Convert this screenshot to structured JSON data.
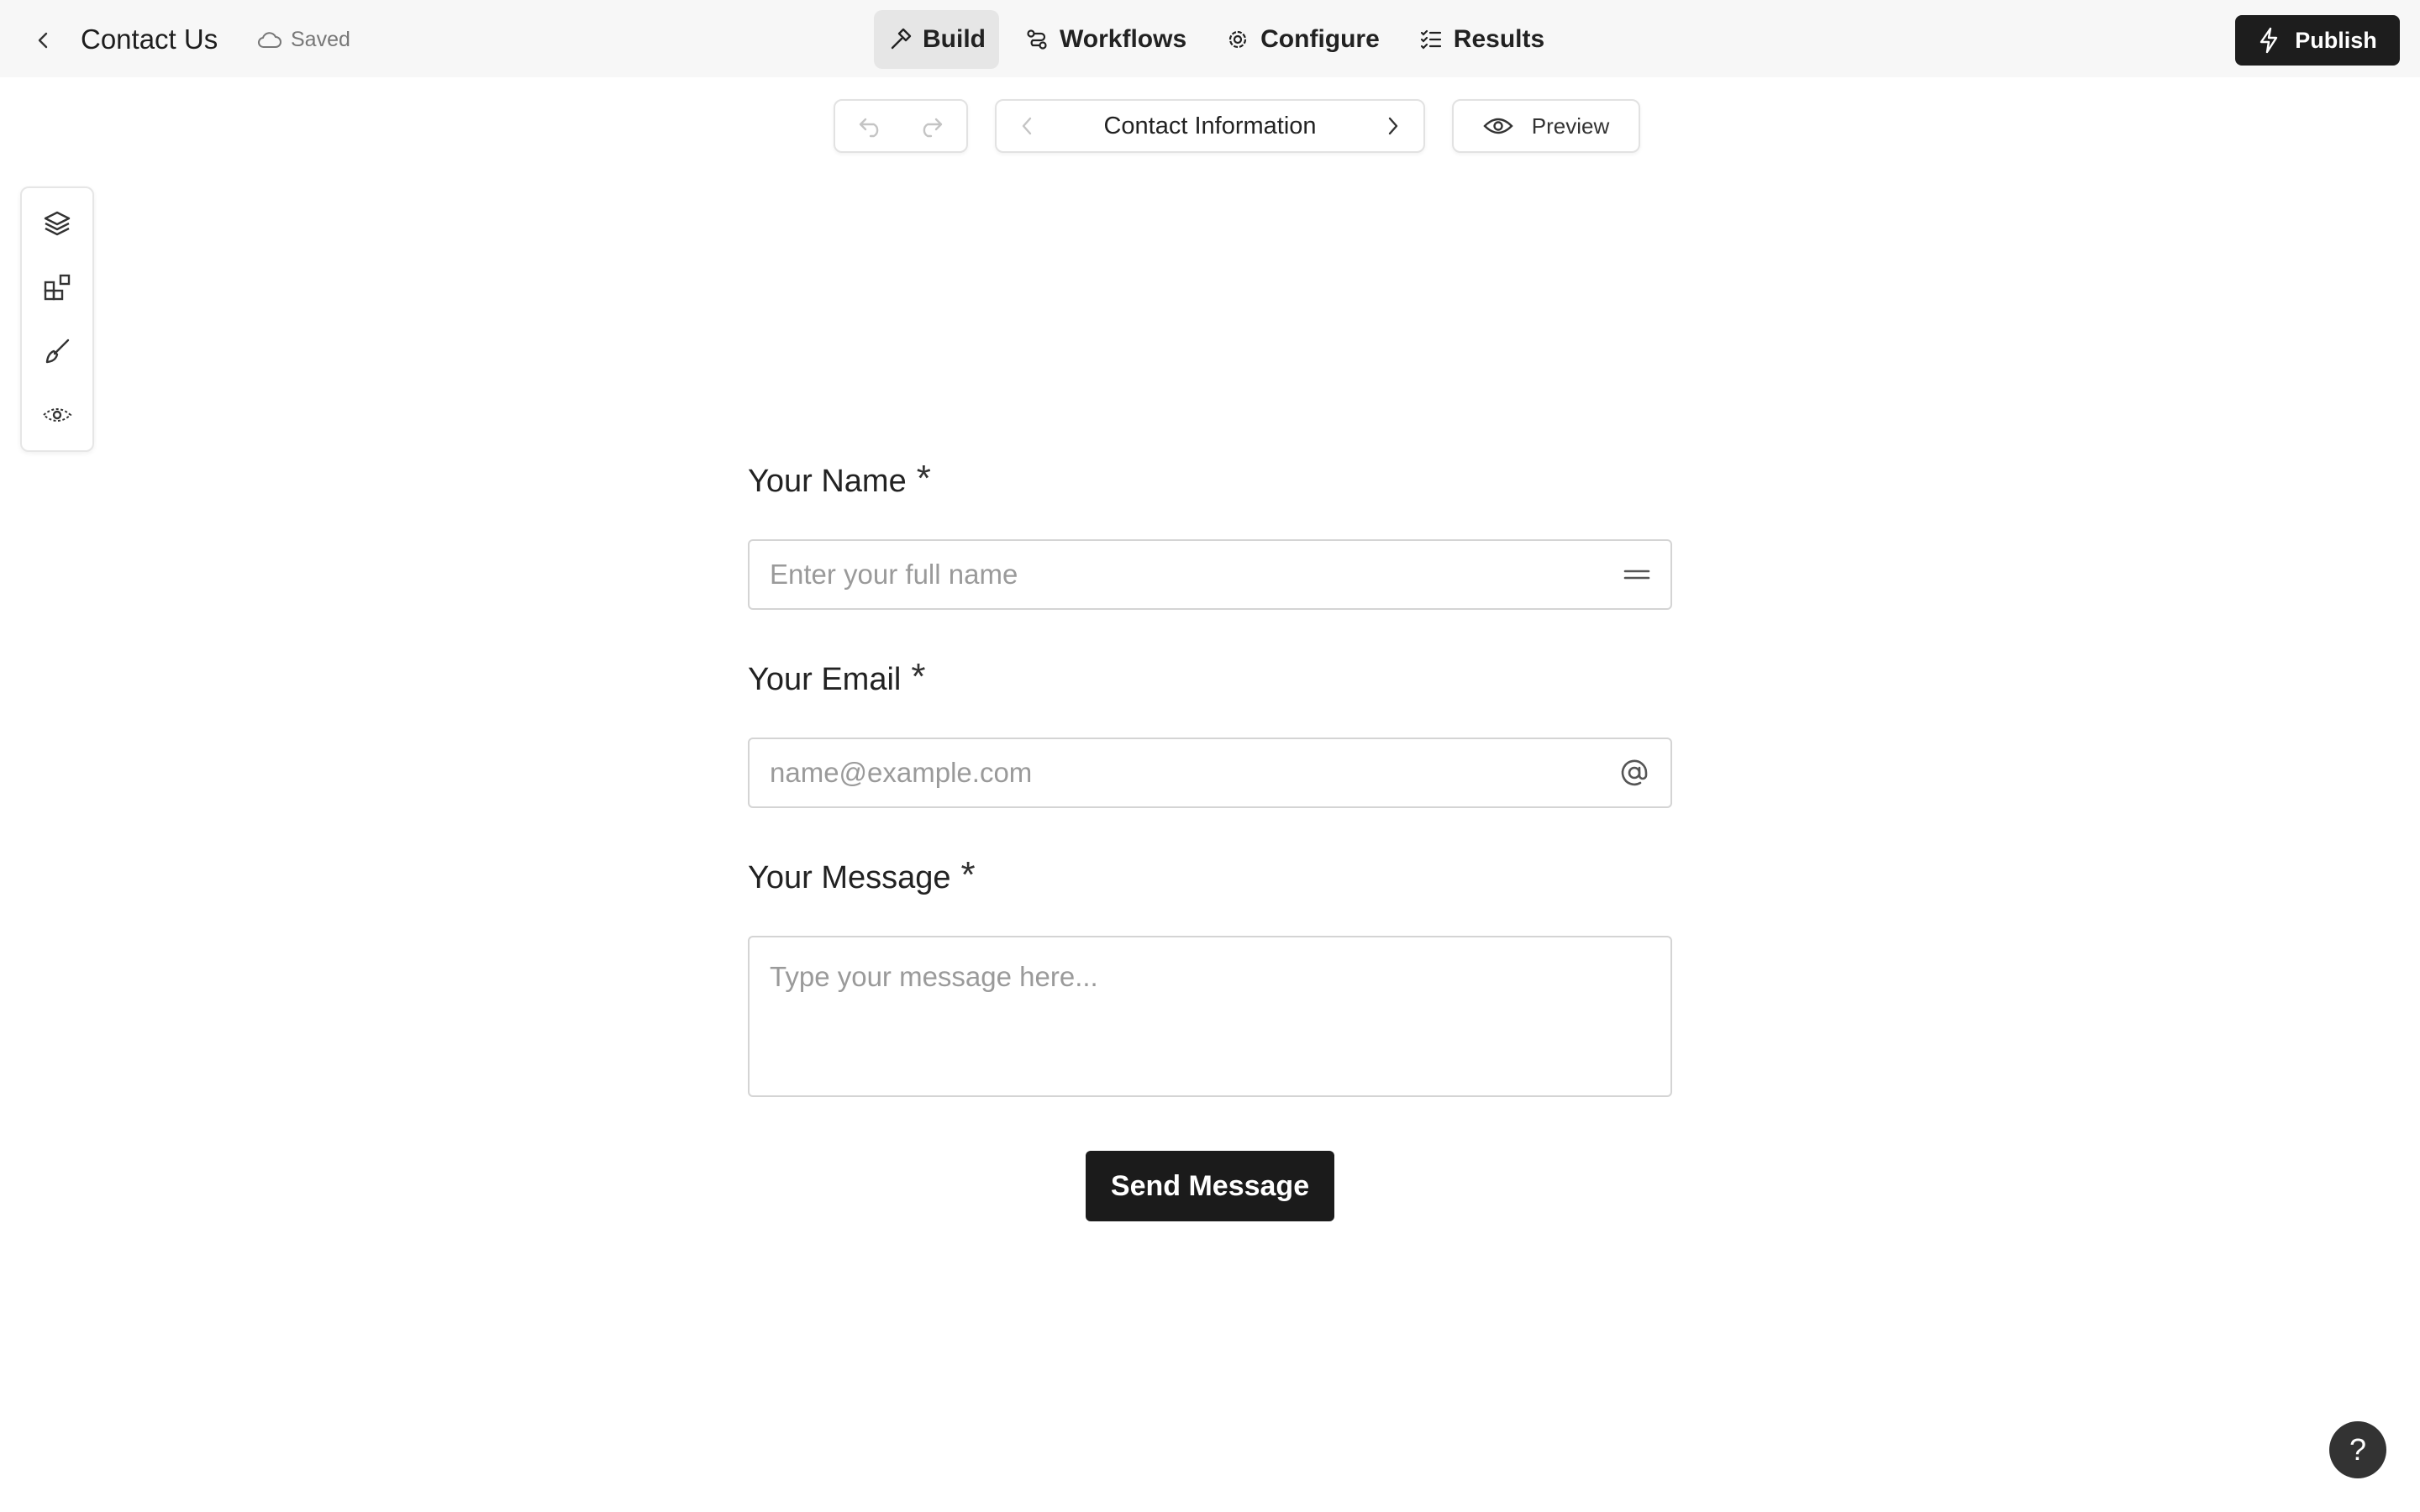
{
  "header": {
    "title": "Contact Us",
    "save_status": "Saved",
    "tabs": [
      {
        "label": "Build",
        "icon": "hammer-icon",
        "active": true
      },
      {
        "label": "Workflows",
        "icon": "workflow-icon"
      },
      {
        "label": "Configure",
        "icon": "gear-icon"
      },
      {
        "label": "Results",
        "icon": "checklist-icon"
      }
    ],
    "publish_label": "Publish"
  },
  "toolbar": {
    "page_name": "Contact Information",
    "preview_label": "Preview"
  },
  "tool_panel": {
    "items": [
      "layers-icon",
      "blocks-icon",
      "brush-icon",
      "logic-icon"
    ]
  },
  "form": {
    "fields": [
      {
        "label": "Your Name",
        "required_mark": "*",
        "placeholder": "Enter your full name",
        "icon": "equals-icon"
      },
      {
        "label": "Your Email",
        "required_mark": "*",
        "placeholder": "name@example.com",
        "icon": "at-icon"
      },
      {
        "label": "Your Message",
        "required_mark": "*",
        "placeholder": "Type your message here..."
      }
    ],
    "submit_label": "Send Message"
  },
  "help_label": "?",
  "colors": {
    "topbar_bg": "#f7f7f7",
    "active_tab_bg": "#e6e6e6",
    "primary_button": "#1b1b1b"
  }
}
